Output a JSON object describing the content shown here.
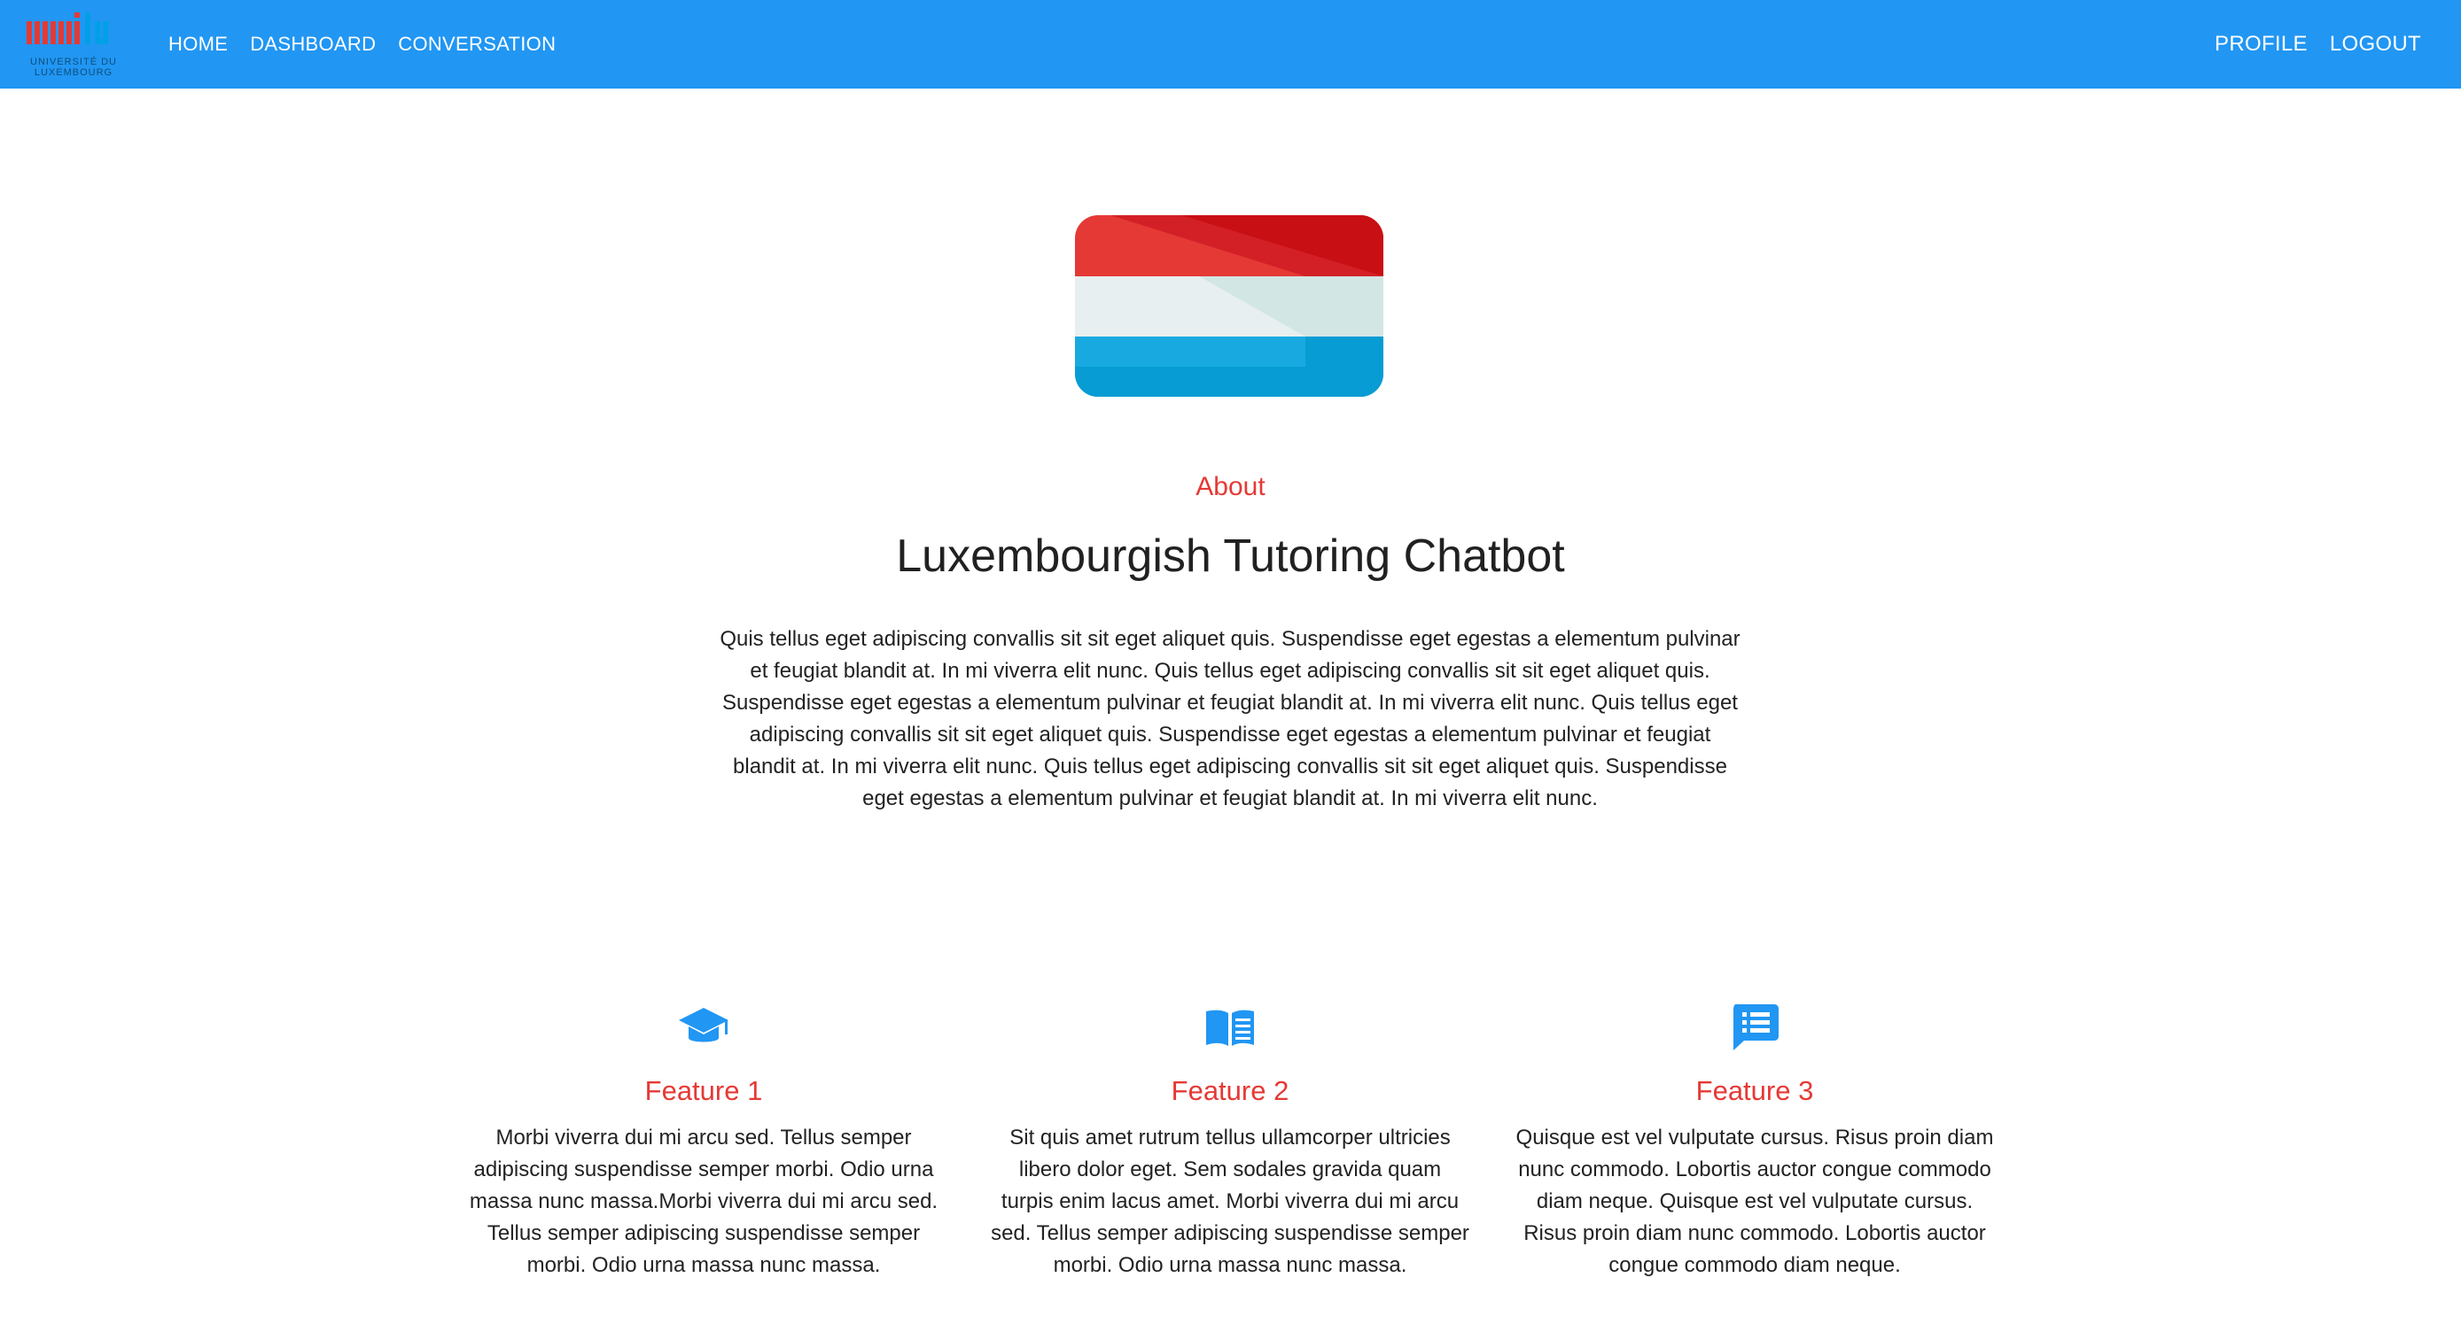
{
  "header": {
    "logo_caption": "UNIVERSITÉ DU LUXEMBOURG",
    "nav_left": [
      "HOME",
      "DASHBOARD",
      "CONVERSATION"
    ],
    "nav_right": [
      "PROFILE",
      "LOGOUT"
    ]
  },
  "hero": {
    "image": "luxembourg-flag-icon",
    "about_label": "About",
    "title": "Luxembourgish Tutoring Chatbot",
    "description": "Quis tellus eget adipiscing convallis sit sit eget aliquet quis. Suspendisse eget egestas a elementum pulvinar et feugiat blandit at. In mi viverra elit nunc. Quis tellus eget adipiscing convallis sit sit eget aliquet quis. Suspendisse eget egestas a elementum pulvinar et feugiat blandit at. In mi viverra elit nunc. Quis tellus eget adipiscing convallis sit sit eget aliquet quis. Suspendisse eget egestas a elementum pulvinar et feugiat blandit at. In mi viverra elit nunc. Quis tellus eget adipiscing convallis sit sit eget aliquet quis. Suspendisse eget egestas a elementum pulvinar et feugiat blandit at. In mi viverra elit nunc."
  },
  "features": [
    {
      "icon": "graduation-cap-icon",
      "title": "Feature 1",
      "text": "Morbi viverra dui mi arcu sed. Tellus semper adipiscing suspendisse semper morbi. Odio urna massa nunc massa.Morbi viverra dui mi arcu sed. Tellus semper adipiscing suspendisse semper morbi. Odio urna massa nunc massa."
    },
    {
      "icon": "open-book-icon",
      "title": "Feature 2",
      "text": "Sit quis amet rutrum tellus ullamcorper ultricies libero dolor eget. Sem sodales gravida quam turpis enim lacus amet. Morbi viverra dui mi arcu sed. Tellus semper adipiscing suspendisse semper morbi. Odio urna massa nunc massa."
    },
    {
      "icon": "chat-list-icon",
      "title": "Feature 3",
      "text": "Quisque est vel vulputate cursus. Risus proin diam nunc commodo. Lobortis auctor congue commodo diam neque. Quisque est vel vulputate cursus. Risus proin diam nunc commodo. Lobortis auctor congue commodo diam neque."
    }
  ],
  "colors": {
    "header_bg": "#2196f3",
    "accent_red": "#e53935",
    "icon_blue": "#2196f3"
  }
}
